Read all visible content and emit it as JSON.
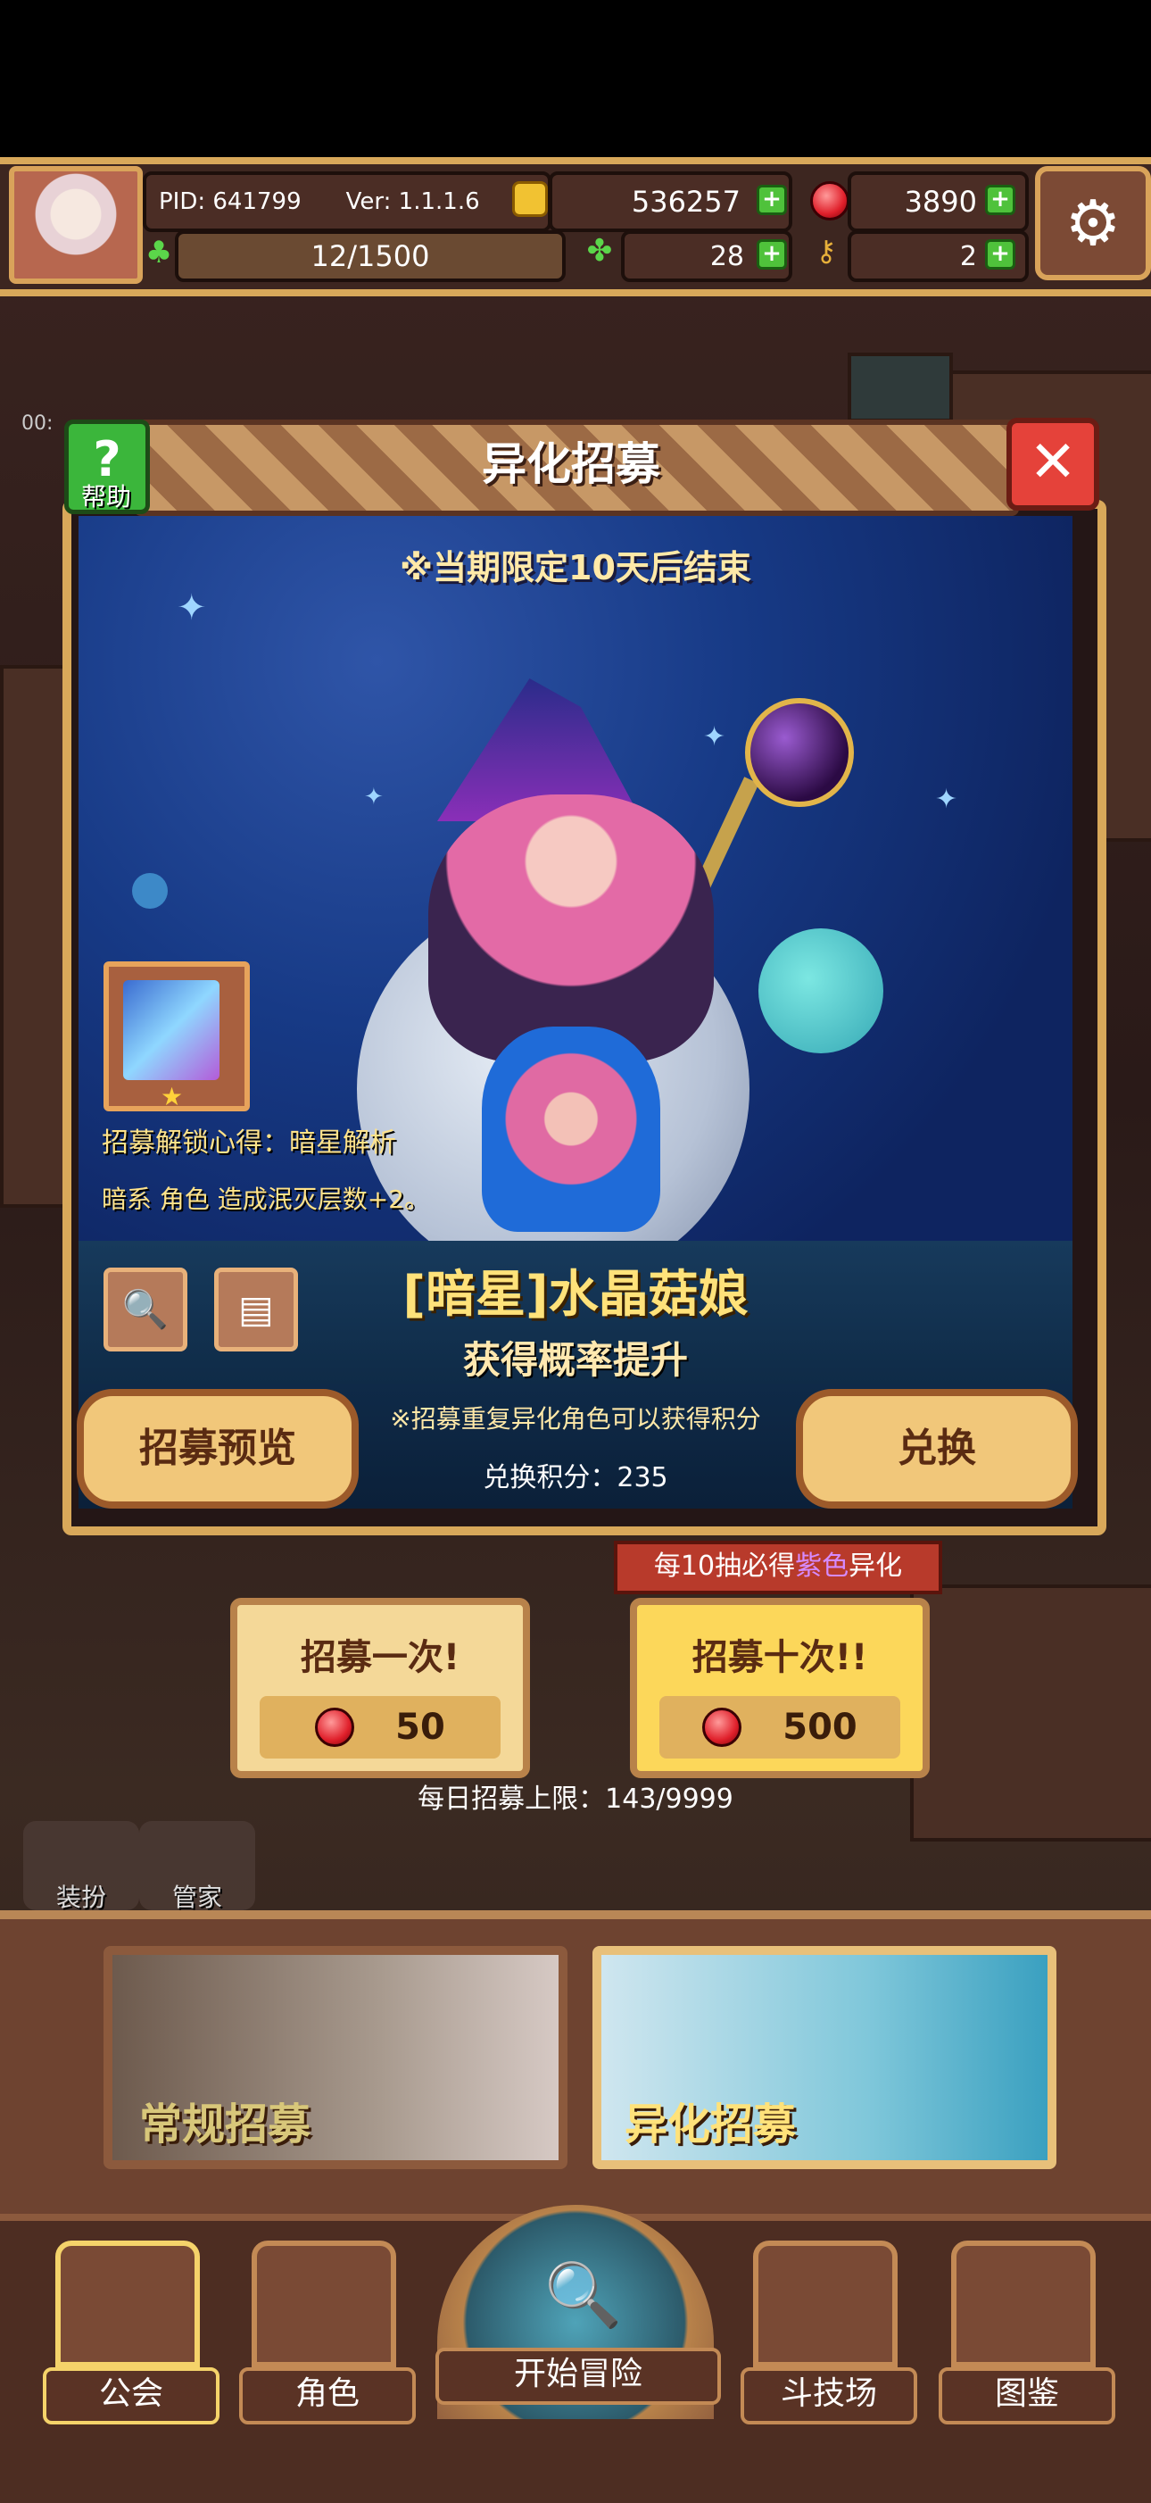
{
  "topbar": {
    "pid": "PID: 641799",
    "version": "Ver: 1.1.1.6",
    "gold": "536257",
    "gems": "3890",
    "stamina": "12/1500",
    "clover": "28",
    "keys": "2"
  },
  "dialog": {
    "title": "异化招募",
    "help_label": "帮助",
    "close_glyph": "✕",
    "limited_notice": "※当期限定10天后结束",
    "unlock_label": "招募解锁心得：暗星解析",
    "unlock_desc": "暗系 角色 造成泯灭层数+2。",
    "character_name": "[暗星]水晶菇娘",
    "rate_up": "获得概率提升",
    "preview_button": "招募预览",
    "exchange_button": "兑换",
    "duplicate_note": "※招募重复异化角色可以获得积分",
    "exchange_points": "兑换积分：235",
    "search_glyph": "🔍",
    "list_glyph": "▤"
  },
  "pull": {
    "guarantee_prefix": "每10抽必得",
    "guarantee_highlight": "紫色",
    "guarantee_suffix": "异化",
    "single_label": "招募一次!",
    "single_cost": "50",
    "ten_label": "招募十次!!",
    "ten_cost": "500",
    "daily_limit": "每日招募上限：143/9999"
  },
  "side_buttons": {
    "dress": "装扮",
    "butler": "管家",
    "timer": "00:"
  },
  "banners": {
    "normal": "常规招募",
    "special": "异化招募"
  },
  "nav": {
    "guild": "公会",
    "character": "角色",
    "adventure": "开始冒险",
    "arena": "斗技场",
    "codex": "图鉴"
  },
  "colors": {
    "accent_gold": "#d8a85a",
    "plus_green": "#4fc23b",
    "close_red": "#e5423a",
    "highlight_purple": "#d58bff"
  }
}
